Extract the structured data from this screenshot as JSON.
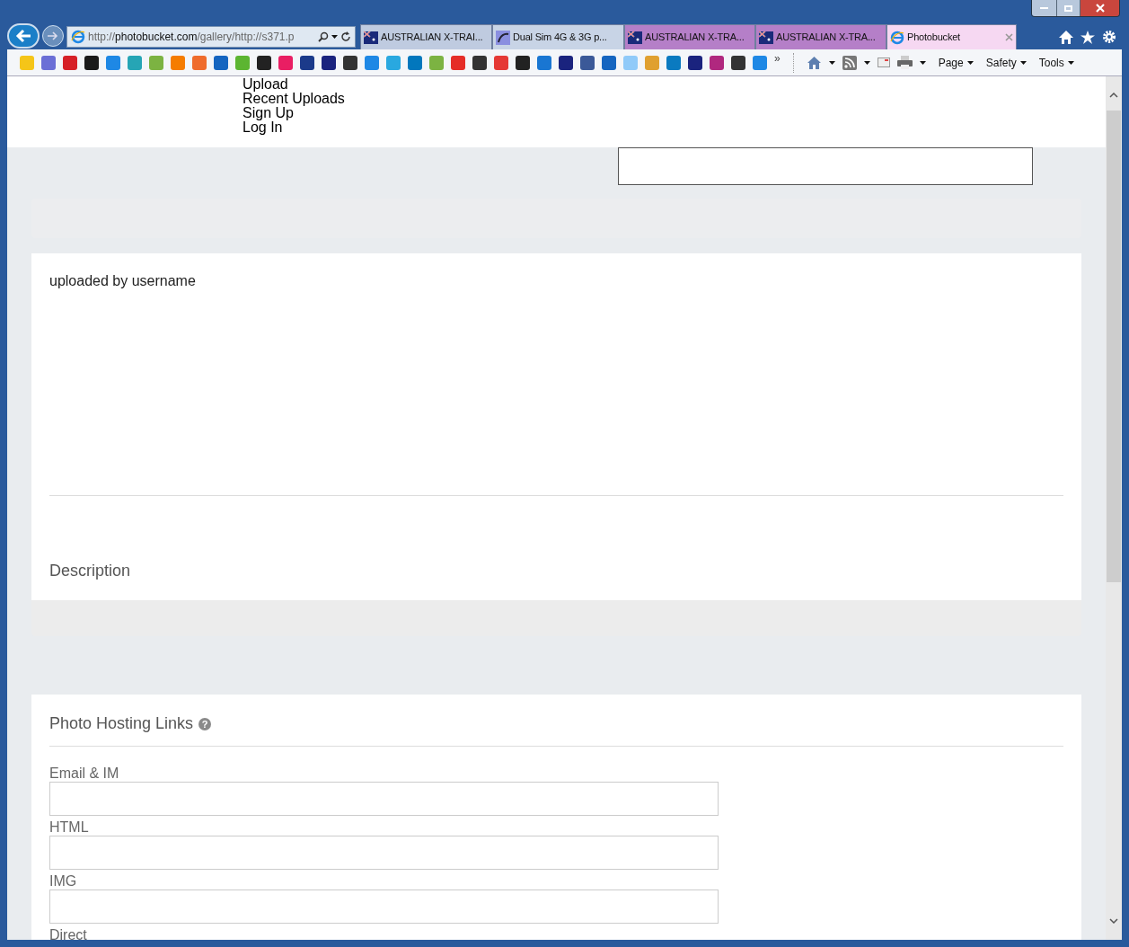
{
  "browser": {
    "address": "http://**photobucket.com**/gallery/http://s371.p",
    "tabs": [
      {
        "label": "AUSTRALIAN X-TRAI...",
        "kind": "flag",
        "selected": false
      },
      {
        "label": "Dual Sim 4G & 3G p...",
        "kind": "site",
        "selected": false
      },
      {
        "label": "AUSTRALIAN X-TRA...",
        "kind": "flag",
        "selected": false
      },
      {
        "label": "AUSTRALIAN X-TRA...",
        "kind": "flag",
        "selected": false
      },
      {
        "label": "Photobucket",
        "kind": "ie",
        "selected": true
      }
    ],
    "overflow": "»",
    "commands": [
      "Page",
      "Safety",
      "Tools"
    ]
  },
  "nav": [
    "Upload",
    "Recent Uploads",
    "Sign Up",
    "Log In"
  ],
  "media": {
    "uploader": "uploaded by username",
    "description_label": "Description"
  },
  "links": {
    "title": "Photo Hosting Links",
    "help": "?",
    "fields": [
      {
        "label": "Email & IM"
      },
      {
        "label": "HTML"
      },
      {
        "label": "IMG"
      },
      {
        "label": "Direct"
      }
    ]
  }
}
